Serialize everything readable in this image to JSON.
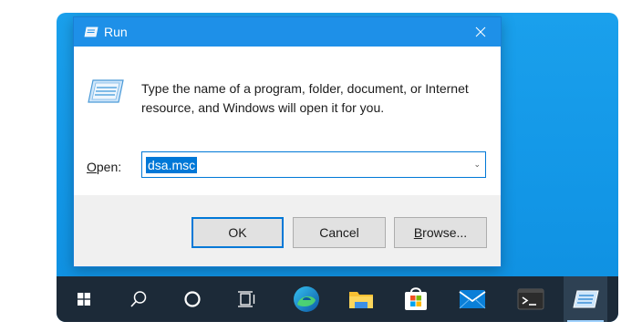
{
  "dialog": {
    "title": "Run",
    "close_glyph": "✕",
    "description": "Type the name of a program, folder, document, or Internet resource, and Windows will open it for you.",
    "open_label_prefix": "O",
    "open_label_rest": "pen:",
    "command_value": "dsa.msc",
    "dropdown_glyph": "⌄",
    "buttons": {
      "ok": "OK",
      "cancel": "Cancel",
      "browse_underlined": "B",
      "browse_rest": "rowse..."
    }
  },
  "taskbar": {
    "items": [
      {
        "name": "start-button",
        "icon": "windows-logo-icon"
      },
      {
        "name": "search-button",
        "icon": "search-icon"
      },
      {
        "name": "cortana-button",
        "icon": "circle-icon"
      },
      {
        "name": "task-view-button",
        "icon": "task-view-icon"
      },
      {
        "name": "edge-button",
        "icon": "edge-icon"
      },
      {
        "name": "file-explorer-button",
        "icon": "folder-icon"
      },
      {
        "name": "store-button",
        "icon": "store-icon"
      },
      {
        "name": "mail-button",
        "icon": "mail-icon"
      },
      {
        "name": "terminal-button",
        "icon": "terminal-icon"
      },
      {
        "name": "run-taskbar-button",
        "icon": "run-icon",
        "active": true
      }
    ]
  },
  "colors": {
    "accent": "#0078d7",
    "titlebar": "#1e90e8",
    "desktop": "#1296e6",
    "taskbar": "#1c2a38"
  }
}
